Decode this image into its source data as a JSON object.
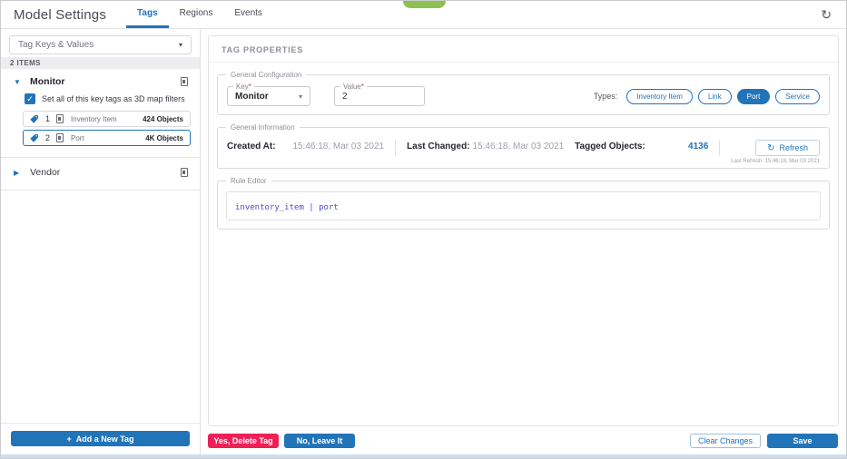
{
  "icons": {
    "dropdown_caret": "▾",
    "select_caret": "▾",
    "group_expanded": "▼",
    "group_collapsed": "▶",
    "check": "✓",
    "refresh": "↻",
    "plus": "+"
  },
  "colors": {
    "accent_blue": "#2274b9",
    "danger_red": "#ee2058",
    "toast_green": "#8cc152"
  },
  "header": {
    "title": "Model Settings",
    "tabs": [
      {
        "label": "Tags",
        "active": true
      },
      {
        "label": "Regions",
        "active": false
      },
      {
        "label": "Events",
        "active": false
      }
    ]
  },
  "sidebar": {
    "dropdown_label": "Tag Keys & Values",
    "items_count": "2 ITEMS",
    "groups": [
      {
        "name": "Monitor",
        "expanded": true,
        "filter_checkbox": {
          "checked": true,
          "label": "Set all of this key tags as 3D map filters"
        },
        "tags": [
          {
            "value": "1",
            "type": "Inventory Item",
            "count": "424 Objects",
            "selected": false
          },
          {
            "value": "2",
            "type": "Port",
            "count": "4K Objects",
            "selected": true
          }
        ]
      },
      {
        "name": "Vendor",
        "expanded": false
      }
    ],
    "add_button_label": "Add a New Tag"
  },
  "main": {
    "title": "TAG PROPERTIES",
    "general_configuration": {
      "legend": "General Configuration",
      "key": {
        "label": "Key",
        "required": "*",
        "value": "Monitor"
      },
      "value": {
        "label": "Value",
        "required": "*",
        "value": "2"
      },
      "types_label": "Types:",
      "types": [
        {
          "label": "Inventory Item",
          "selected": false
        },
        {
          "label": "Link",
          "selected": false
        },
        {
          "label": "Port",
          "selected": true
        },
        {
          "label": "Service",
          "selected": false
        }
      ]
    },
    "general_information": {
      "legend": "General Information",
      "created_at_label": "Created At:",
      "created_at": "15:46:18, Mar 03 2021",
      "last_changed_label": "Last Changed:",
      "last_changed": "15:46:18, Mar 03 2021",
      "tagged_objects_label": "Tagged Objects:",
      "tagged_objects": "4136",
      "refresh_button_label": "Refresh",
      "last_refresh_note": "Last Refresh: 15:46:18, Mar 03 2021"
    },
    "rule_editor": {
      "legend": "Rule Editor",
      "rule": "inventory_item | port"
    },
    "footer": {
      "delete_confirm_label": "Yes, Delete Tag",
      "delete_cancel_label": "No, Leave It",
      "clear_label": "Clear Changes",
      "save_label": "Save"
    }
  }
}
